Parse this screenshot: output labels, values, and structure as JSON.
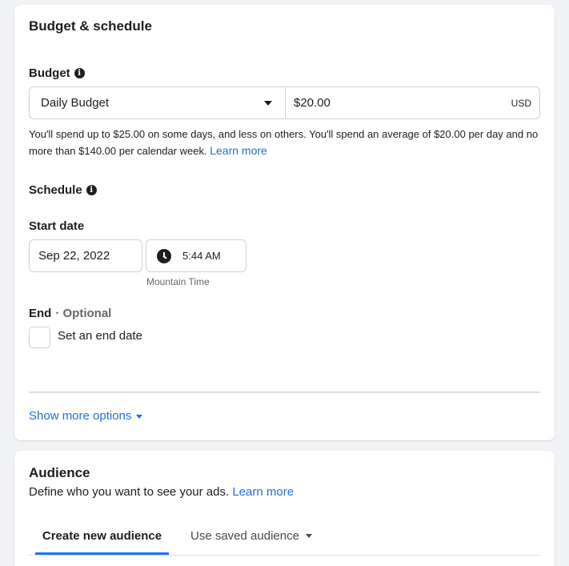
{
  "budget_schedule": {
    "title": "Budget & schedule",
    "budget_label": "Budget",
    "budget_type": "Daily Budget",
    "budget_amount": "$20.00",
    "currency": "USD",
    "help_text": "You'll spend up to $25.00 on some days, and less on others. You'll spend an average of $20.00 per day and no more than $140.00 per calendar week.",
    "learn_more": "Learn more",
    "schedule_label": "Schedule",
    "start_date_label": "Start date",
    "start_date": "Sep 22, 2022",
    "start_time": "5:44 AM",
    "timezone": "Mountain Time",
    "end_label": "End",
    "optional_label": "· Optional",
    "end_checkbox_label": "Set an end date",
    "end_checkbox_checked": false,
    "show_more": "Show more options"
  },
  "audience": {
    "title": "Audience",
    "description": "Define who you want to see your ads.",
    "learn_more": "Learn more",
    "tabs": [
      {
        "label": "Create new audience",
        "active": true
      },
      {
        "label": "Use saved audience",
        "active": false
      }
    ]
  },
  "colors": {
    "link": "#216fdb",
    "tab_active_underline": "#1877f2",
    "page_background": "#f0f2f5"
  },
  "icons": [
    "info-icon",
    "chevron-down-icon",
    "clock-icon"
  ]
}
